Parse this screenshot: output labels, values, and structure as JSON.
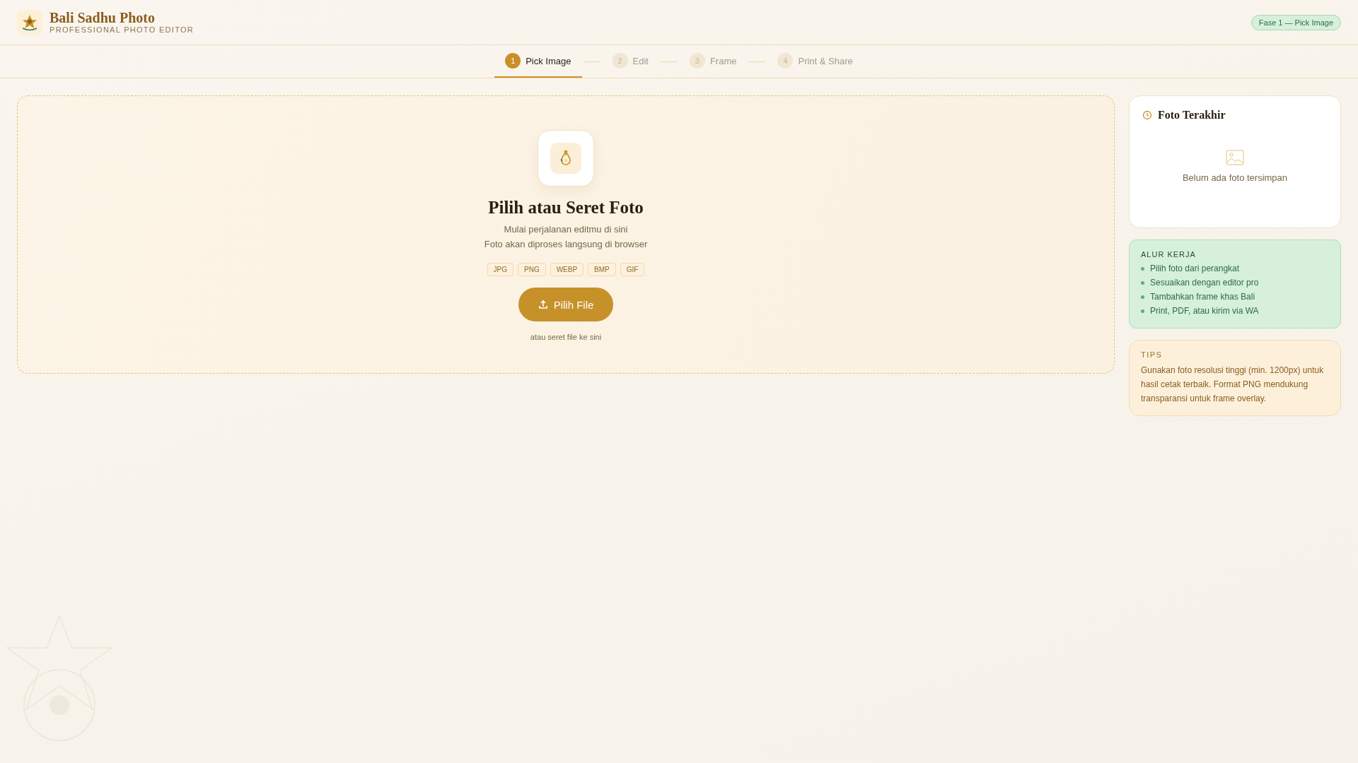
{
  "header": {
    "title": "Bali Sadhu Photo",
    "subtitle": "PROFESSIONAL PHOTO EDITOR",
    "phase_badge": "Fase 1 — Pick Image"
  },
  "steps": [
    {
      "number": "1",
      "label": "Pick Image",
      "selected": true
    },
    {
      "number": "2",
      "label": "Edit",
      "selected": false
    },
    {
      "number": "3",
      "label": "Frame",
      "selected": false
    },
    {
      "number": "4",
      "label": "Print & Share",
      "selected": false
    }
  ],
  "dropzone": {
    "title": "Pilih atau Seret Foto",
    "lines": [
      "Mulai perjalanan editmu di sini",
      "Foto akan diproses langsung di browser"
    ],
    "formats": [
      "JPG",
      "PNG",
      "WEBP",
      "BMP",
      "GIF"
    ],
    "button": "Pilih File",
    "hint": "atau seret file ke sini"
  },
  "recent": {
    "title": "Foto Terakhir",
    "empty": "Belum ada foto tersimpan"
  },
  "workflow": {
    "title": "ALUR KERJA",
    "items": [
      "Pilih foto dari perangkat",
      "Sesuaikan dengan editor pro",
      "Tambahkan frame khas Bali",
      "Print, PDF, atau kirim via WA"
    ]
  },
  "tips": {
    "title": "TIPS",
    "text": "Gunakan foto resolusi tinggi (min. 1200px) untuk hasil cetak terbaik. Format PNG mendukung transparansi untuk frame overlay."
  }
}
